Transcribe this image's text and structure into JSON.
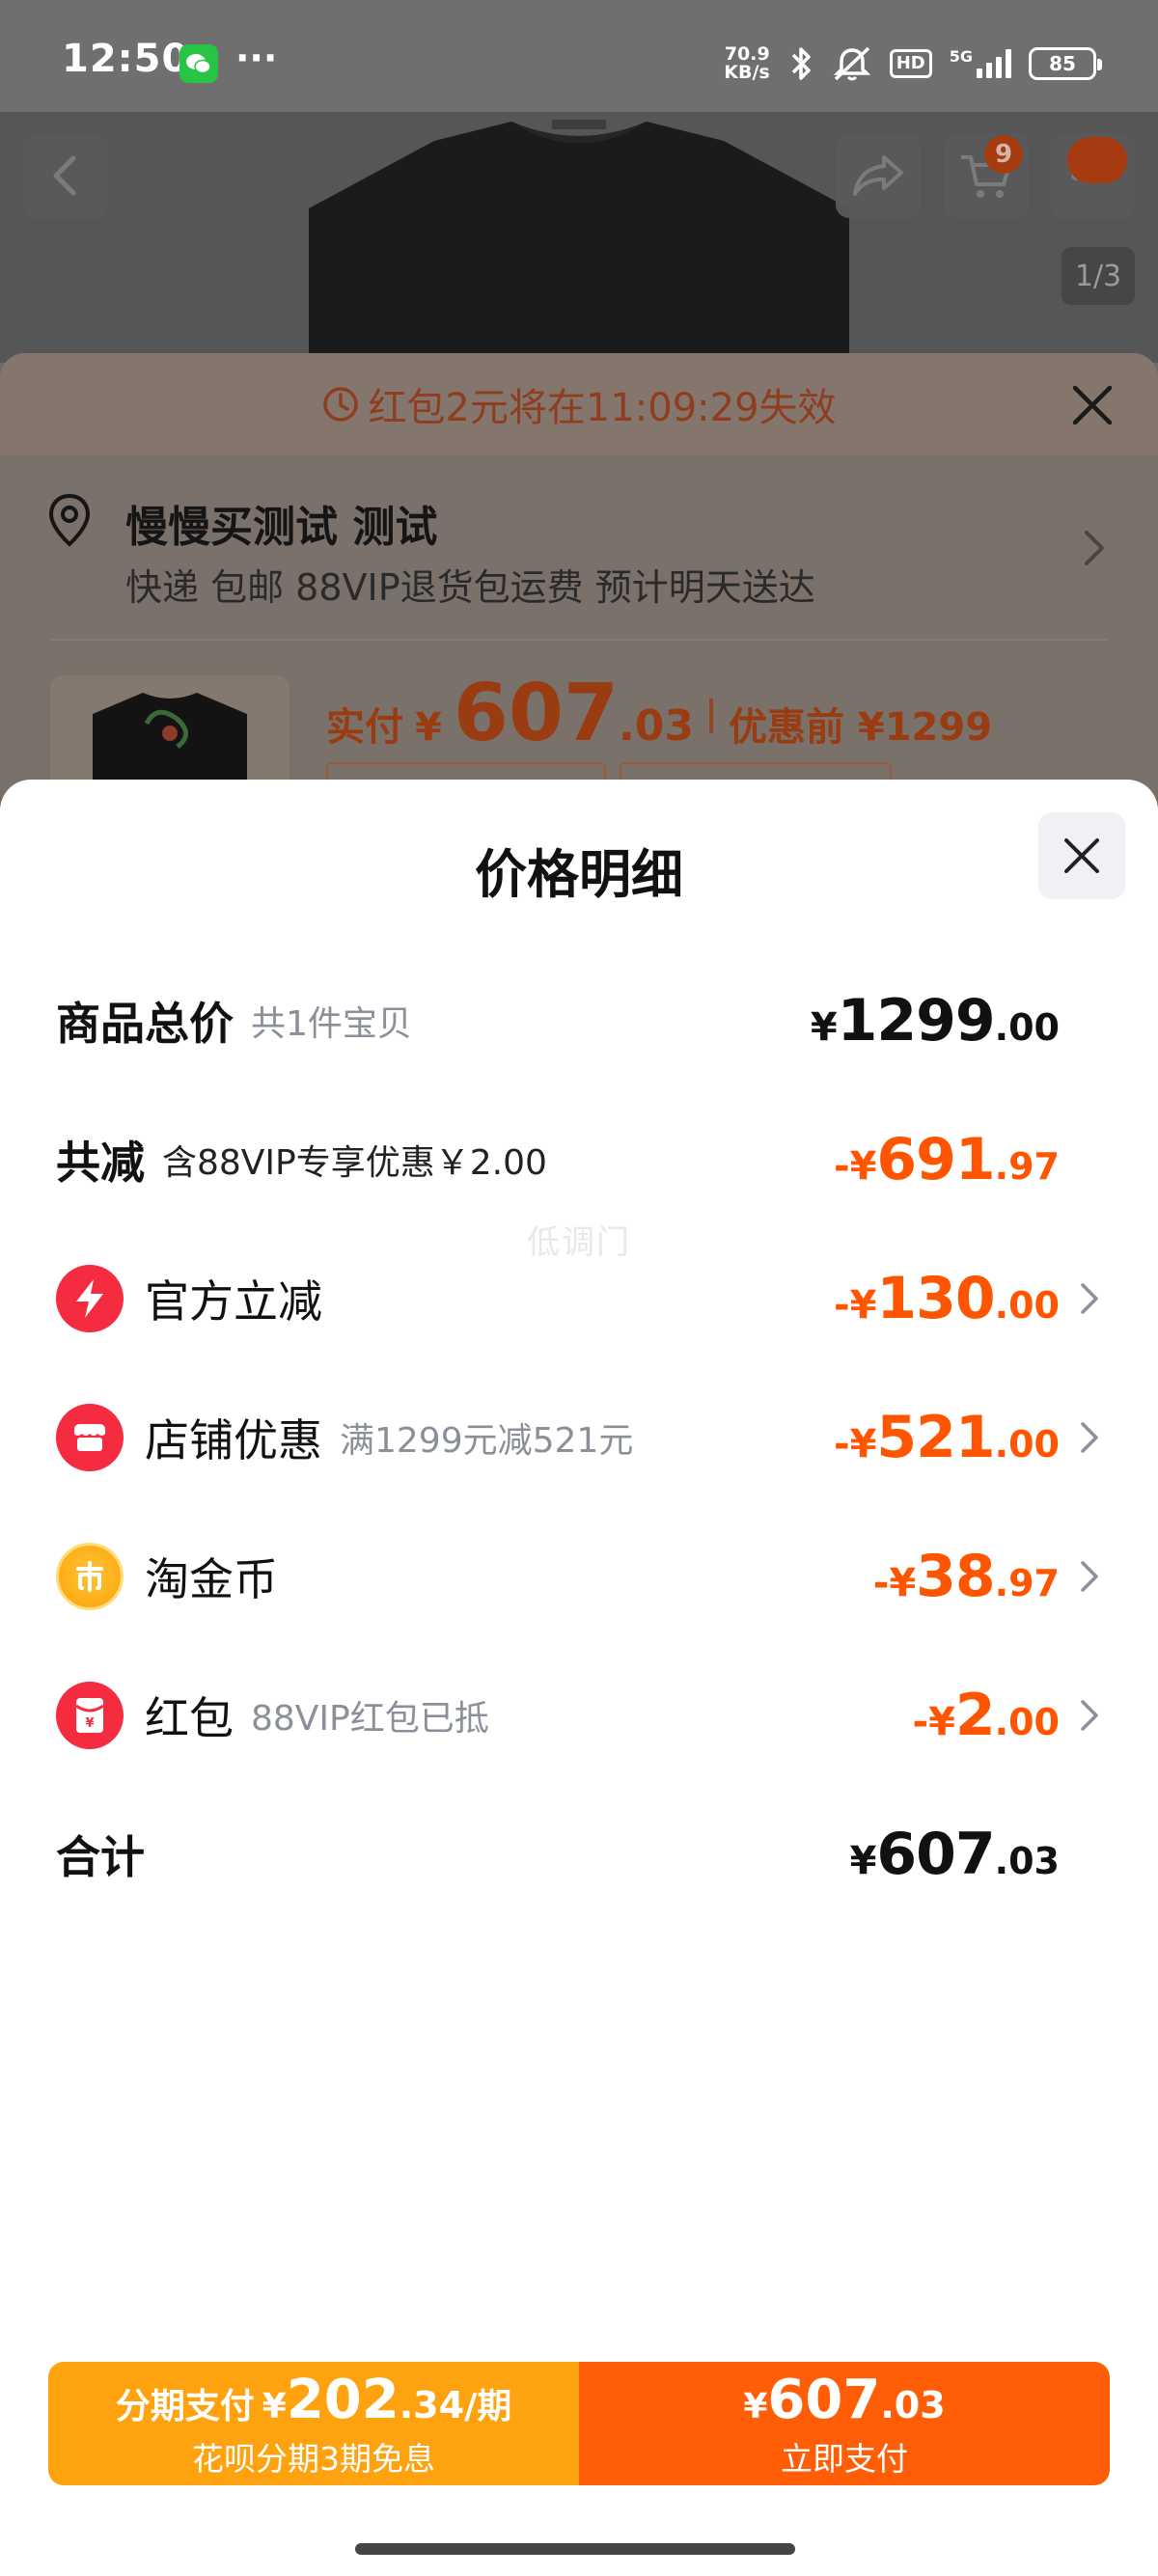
{
  "status_bar": {
    "time": "12:50",
    "net_speed_value": "70.9",
    "net_speed_unit": "KB/s",
    "hd_label": "HD",
    "network_label": "5G",
    "battery_level": "85"
  },
  "product": {
    "image_counter": "1/3",
    "cart_count": "9"
  },
  "checkout": {
    "coupon_notice": "红包2元将在11:09:29失效",
    "address_name": "慢慢买测试 测试",
    "address_detail": "快递 包邮 88VIP退货包运费 预计明天送达",
    "paid_label": "实付",
    "paid_yen": "¥",
    "paid_int": "607",
    "paid_dec": ".03",
    "before_discount": "优惠前 ¥1299"
  },
  "price_detail": {
    "title": "价格明细",
    "watermark": "低调门",
    "rows": [
      {
        "label": "商品总价",
        "sub": "共1件宝贝",
        "yen": "¥",
        "int": "1299",
        "dec": ".00"
      },
      {
        "label": "共减",
        "sub": "含88VIP专享优惠￥2.00",
        "yen": "-¥",
        "int": "691",
        "dec": ".97"
      },
      {
        "label": "官方立减",
        "sub": "",
        "yen": "-¥",
        "int": "130",
        "dec": ".00",
        "icon": "lightning-icon"
      },
      {
        "label": "店铺优惠",
        "sub": "满1299元减521元",
        "yen": "-¥",
        "int": "521",
        "dec": ".00",
        "icon": "shop-icon"
      },
      {
        "label": "淘金币",
        "sub": "",
        "yen": "-¥",
        "int": "38",
        "dec": ".97",
        "icon": "coin-icon"
      },
      {
        "label": "红包",
        "sub": "88VIP红包已抵",
        "yen": "-¥",
        "int": "2",
        "dec": ".00",
        "icon": "red-packet-icon"
      },
      {
        "label": "合计",
        "sub": "",
        "yen": "¥",
        "int": "607",
        "dec": ".03"
      }
    ]
  },
  "pay_bar": {
    "installment_label": "分期支付",
    "installment_yen": "¥",
    "installment_int": "202",
    "installment_dec": ".34",
    "installment_per": "/期",
    "installment_sub": "花呗分期3期免息",
    "pay_yen": "¥",
    "pay_int": "607",
    "pay_dec": ".03",
    "pay_label": "立即支付"
  },
  "colors": {
    "accent_orange": "#ff5500",
    "installment_bg": "#ffa20f",
    "pay_bg": "#ff5e06",
    "icon_red": "#f52c3f"
  }
}
